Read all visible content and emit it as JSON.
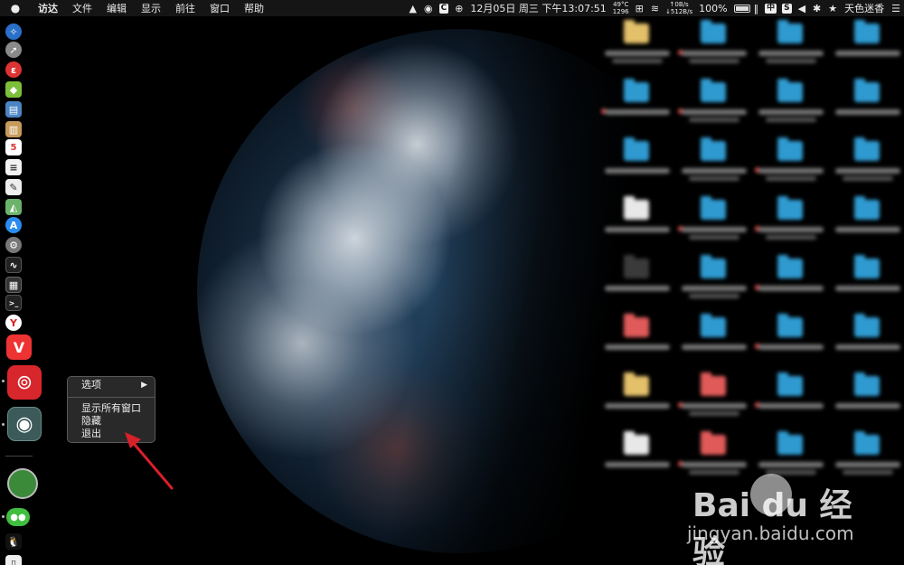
{
  "menubar": {
    "apple_icon": "apple-logo",
    "menus": [
      "访达",
      "文件",
      "编辑",
      "显示",
      "前往",
      "窗口",
      "帮助"
    ],
    "status": {
      "temp": "49°C",
      "fan": "1296",
      "net_up": "↑0B/s",
      "net_down": "↓512B/s",
      "datetime": "12月05日 周三 下午13:07:51",
      "battery": "100%",
      "input_method": "中",
      "s_badge": "S",
      "c_badge": "C",
      "user": "天色迷香"
    }
  },
  "context_menu": {
    "items": [
      "选项",
      "显示所有窗口",
      "隐藏",
      "退出"
    ],
    "submenu_arrow": "▶"
  },
  "dock": {
    "icons": [
      "safari-icon",
      "launchpad-icon",
      "app-red-icon",
      "android-icon",
      "preview-icon",
      "notes-icon",
      "calendar-icon",
      "reminders-icon",
      "textedit-icon",
      "maps-icon",
      "appstore-icon",
      "settings-icon",
      "activity-monitor-icon",
      "terminal-icon",
      "yandex-icon",
      "vivaldi-icon",
      "netease-music-icon",
      "eye-app-icon",
      "green-app-icon",
      "wechat-icon",
      "qq-icon"
    ],
    "calendar_day": "5"
  },
  "watermark": {
    "logo_text": "Bai du 经验",
    "url": "jingyan.baidu.com"
  }
}
